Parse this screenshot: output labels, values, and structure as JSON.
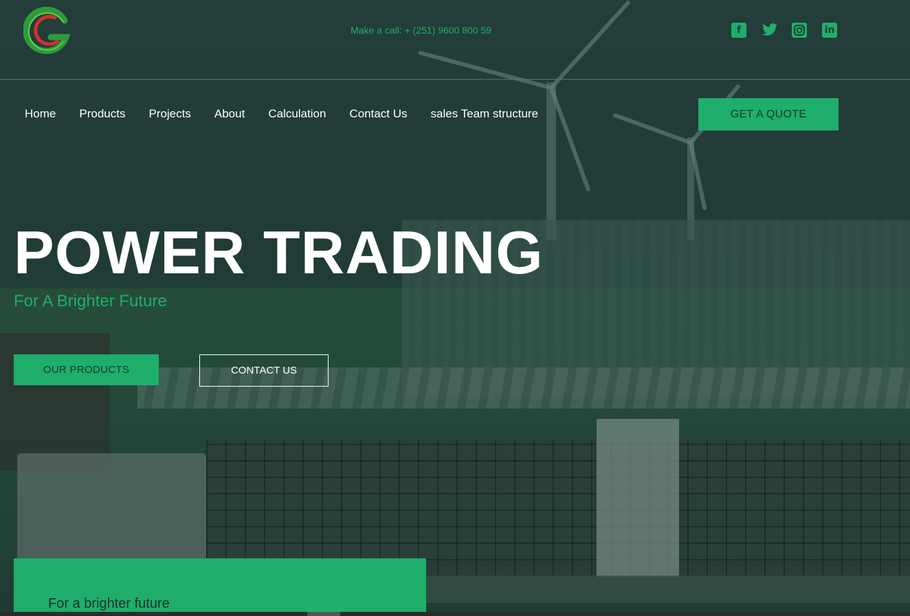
{
  "header": {
    "phone_text": "Make a call: + (251) 9600 800 59",
    "social_icons": [
      "facebook-icon",
      "twitter-icon",
      "instagram-icon",
      "linkedin-icon"
    ]
  },
  "nav": {
    "items": [
      "Home",
      "Products",
      "Projects",
      "About",
      "Calculation",
      "Contact Us",
      "sales Team structure"
    ],
    "quote_label": "GET A QUOTE"
  },
  "hero": {
    "title": "POWER TRADING",
    "subtitle": "For A Brighter Future",
    "primary_button": "OUR PRODUCTS",
    "secondary_button": "CONTACT US"
  },
  "panel": {
    "text": "For a brighter future"
  },
  "colors": {
    "accent": "#1fae6b",
    "background": "#1f3a36",
    "text_light": "#ffffff"
  }
}
